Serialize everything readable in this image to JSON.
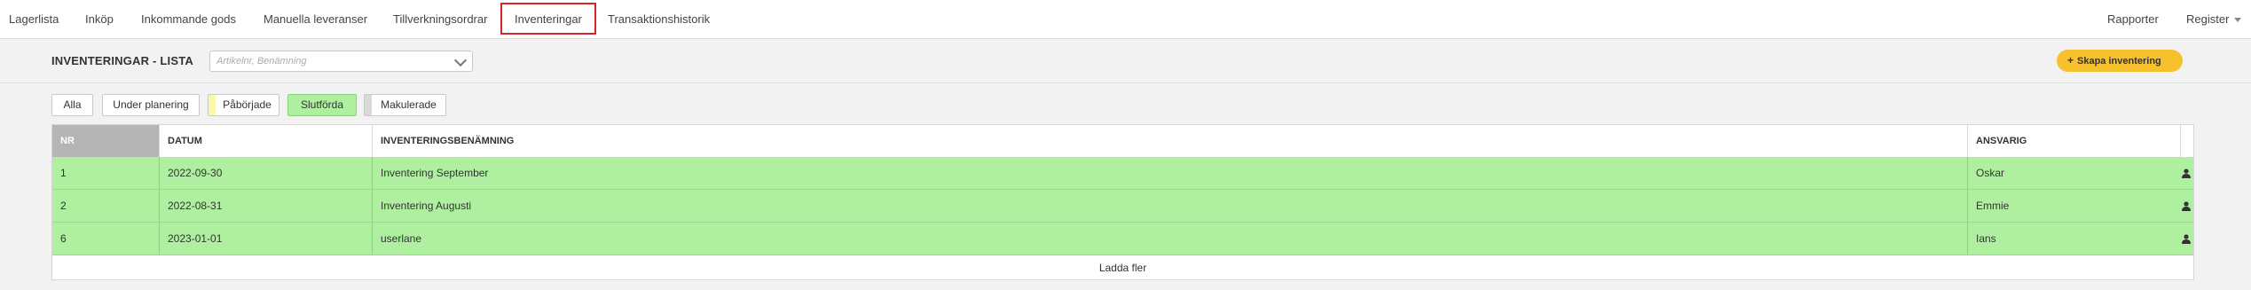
{
  "nav": {
    "items": [
      {
        "label": "Lagerlista"
      },
      {
        "label": "Inköp"
      },
      {
        "label": "Inkommande gods"
      },
      {
        "label": "Manuella leveranser"
      },
      {
        "label": "Tillverkningsordrar"
      },
      {
        "label": "Inventeringar"
      },
      {
        "label": "Transaktionshistorik"
      }
    ],
    "right": {
      "reports": "Rapporter",
      "register": "Register"
    }
  },
  "header": {
    "title": "INVENTERINGAR - LISTA",
    "search_placeholder": "Artikelnr, Benämning",
    "create_button": "Skapa inventering"
  },
  "filters": [
    {
      "label": "Alla",
      "swatch": ""
    },
    {
      "label": "Under planering",
      "swatch": ""
    },
    {
      "label": "Påbörjade",
      "swatch": "#fdf7a8"
    },
    {
      "label": "Slutförda",
      "swatch": "#aef0a0"
    },
    {
      "label": "Makulerade",
      "swatch": "#d9d9d9"
    }
  ],
  "table": {
    "columns": [
      "NR",
      "DATUM",
      "INVENTERINGSBENÄMNING",
      "ANSVARIG"
    ],
    "rows": [
      {
        "nr": "1",
        "date": "2022-09-30",
        "name": "Inventering September",
        "responsible": "Oskar"
      },
      {
        "nr": "2",
        "date": "2022-08-31",
        "name": "Inventering Augusti",
        "responsible": "Emmie"
      },
      {
        "nr": "6",
        "date": "2023-01-01",
        "name": "userlane",
        "responsible": "Ians"
      }
    ],
    "load_more": "Ladda fler"
  },
  "colors": {
    "accent": "#f7c12e",
    "active_nav_border": "#d9232a",
    "completed_row": "#aef0a0"
  }
}
